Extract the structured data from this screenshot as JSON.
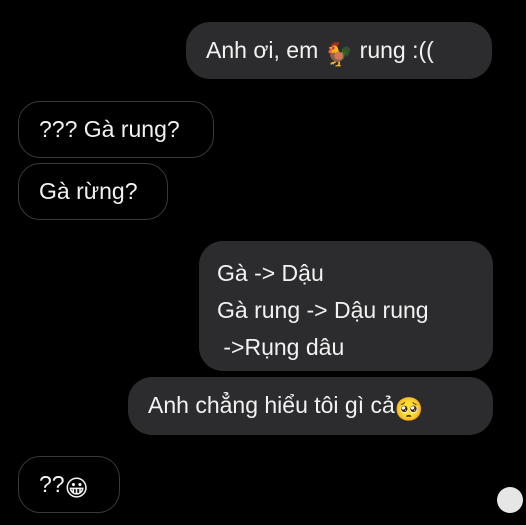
{
  "messages": [
    {
      "side": "outgoing",
      "parts": [
        "Anh ơi, em ",
        "🐓",
        " rung :(("
      ]
    },
    {
      "side": "incoming",
      "text": "??? Gà rung?"
    },
    {
      "side": "incoming",
      "text": "Gà rừng?"
    },
    {
      "side": "outgoing",
      "lines": [
        "Gà -> Dậu",
        "Gà rung -> Dậu rung",
        " ->Rụng dâu"
      ]
    },
    {
      "side": "outgoing",
      "parts": [
        "Anh chẳng hiểu tôi gì cả",
        "🥺"
      ]
    },
    {
      "side": "incoming",
      "parts": [
        "??",
        "😀"
      ]
    }
  ],
  "icons": {
    "rooster": "rooster-emoji",
    "pleading": "pleading-face-emoji",
    "grin": "grinning-face-emoji",
    "corner": "white-circle-icon"
  },
  "colors": {
    "background": "#000000",
    "outgoing_bubble": "#2c2c2e",
    "incoming_border": "#3a3a3c",
    "text": "#f2f2f2"
  }
}
